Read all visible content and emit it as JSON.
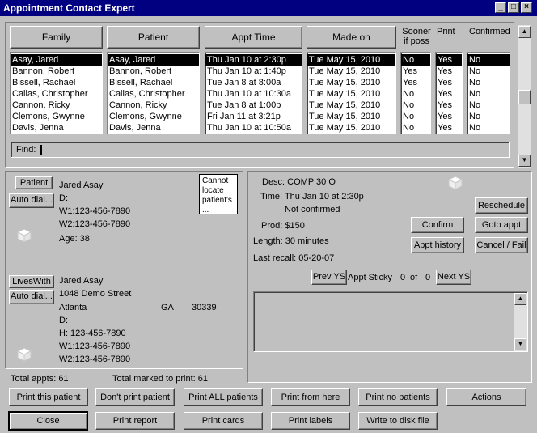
{
  "window": {
    "title": "Appointment Contact Expert"
  },
  "columns": {
    "family": "Family",
    "patient": "Patient",
    "appt_time": "Appt Time",
    "made_on": "Made on",
    "sooner": "Sooner\nif poss",
    "print": "Print",
    "confirmed": "Confirmed"
  },
  "rows": [
    {
      "family": "Asay, Jared",
      "patient": "Asay, Jared",
      "appt_time": "Thu Jan 10 at  2:30p",
      "made_on": "Tue May 15, 2010",
      "sooner": "No",
      "print": "Yes",
      "confirmed": "No"
    },
    {
      "family": "Bannon, Robert",
      "patient": "Bannon, Robert",
      "appt_time": "Thu Jan 10 at  1:40p",
      "made_on": "Tue May 15, 2010",
      "sooner": "Yes",
      "print": "Yes",
      "confirmed": "No"
    },
    {
      "family": "Bissell, Rachael",
      "patient": "Bissell, Rachael",
      "appt_time": "Tue Jan  8 at  8:00a",
      "made_on": "Tue May 15, 2010",
      "sooner": "Yes",
      "print": "Yes",
      "confirmed": "No"
    },
    {
      "family": "Callas, Christopher",
      "patient": "Callas, Christopher",
      "appt_time": "Thu Jan 10 at 10:30a",
      "made_on": "Tue May 15, 2010",
      "sooner": "No",
      "print": "Yes",
      "confirmed": "No"
    },
    {
      "family": "Cannon, Ricky",
      "patient": "Cannon, Ricky",
      "appt_time": "Tue Jan  8 at  1:00p",
      "made_on": "Tue May 15, 2010",
      "sooner": "No",
      "print": "Yes",
      "confirmed": "No"
    },
    {
      "family": "Clemons, Gwynne",
      "patient": "Clemons, Gwynne",
      "appt_time": "Fri Jan 11 at  3:21p",
      "made_on": "Tue May 15, 2010",
      "sooner": "No",
      "print": "Yes",
      "confirmed": "No"
    },
    {
      "family": "Davis, Jenna",
      "patient": "Davis, Jenna",
      "appt_time": "Thu Jan 10 at 10:50a",
      "made_on": "Tue May 15, 2010",
      "sooner": "No",
      "print": "Yes",
      "confirmed": "No"
    }
  ],
  "find": {
    "label": "Find:",
    "value": ""
  },
  "patient_panel": {
    "patient_btn": "Patient",
    "auto_dial_btn": "Auto dial...",
    "name": "Jared Asay",
    "d": "D:",
    "w1": "W1:123-456-7890",
    "w2": "W2:123-456-7890",
    "age": "Age:  38",
    "note": "Cannot locate patient's ..."
  },
  "lives_with_panel": {
    "lives_with_btn": "LivesWith",
    "auto_dial_btn": "Auto dial...",
    "name": "Jared Asay",
    "street": "1048 Demo Street",
    "city": "Atlanta",
    "state": "GA",
    "zip": "30339",
    "d": "D:",
    "h": "H:    123-456-7890",
    "w1": "W1:123-456-7890",
    "w2": "W2:123-456-7890"
  },
  "appt_panel": {
    "desc": "Desc: COMP 30 O",
    "time": "Time:  Thu Jan 10 at  2:30p",
    "status": "Not confirmed",
    "prod": "Prod:  $150",
    "length": "Length:   30 minutes",
    "last_recall": "Last recall:  05-20-07",
    "reschedule": "Reschedule",
    "confirm": "Confirm",
    "goto_appt": "Goto appt",
    "appt_history": "Appt history",
    "cancel_fail": "Cancel / Fail",
    "prev_ys": "Prev YS",
    "sticky_label": "Appt Sticky",
    "sticky_current": "0",
    "sticky_of": "of",
    "sticky_total": "0",
    "next_ys": "Next YS"
  },
  "totals": {
    "total_appts": "Total appts:  61",
    "total_marked": "Total marked to print:  61"
  },
  "buttons": {
    "print_this": "Print this patient",
    "dont_print": "Don't print patient",
    "print_all": "Print ALL patients",
    "print_from_here": "Print from here",
    "print_no": "Print no patients",
    "actions": "Actions",
    "close": "Close",
    "print_report": "Print report",
    "print_cards": "Print cards",
    "print_labels": "Print labels",
    "write_disk": "Write to disk file"
  }
}
